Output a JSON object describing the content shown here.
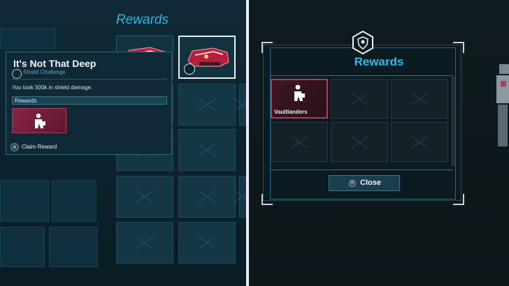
{
  "left_screen": {
    "background_title": "Rewards",
    "popup": {
      "title": "It's Not That Deep",
      "subtitle": "Shield Challenge",
      "subtitle_icon": "shield-icon",
      "description": "You took 500k in shield damage.",
      "rewards_label": "Rewards",
      "reward_icon": "person-icon",
      "claim_button_glyph": "A",
      "claim_button_label": "Claim Reward"
    },
    "items": [
      {
        "name": "vehicle-skin-red",
        "selected": false
      },
      {
        "name": "vehicle-skin-red",
        "selected": true
      }
    ]
  },
  "right_screen": {
    "title": "Rewards",
    "emblem_icon": "shield-emblem-icon",
    "reward_slot": {
      "label": "Vaultlanders",
      "icon": "person-icon"
    },
    "empty_slot_count": 5,
    "close_button_glyph": "B",
    "close_button_label": "Close"
  },
  "colors": {
    "accent_blue": "#34b8ea",
    "reward_red": "#b23a5c",
    "panel_dark": "#0c1b21"
  }
}
